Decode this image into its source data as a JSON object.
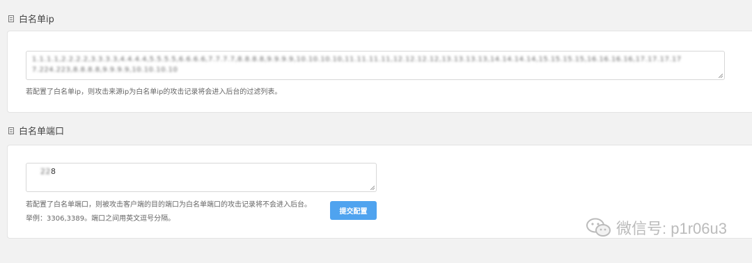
{
  "sections": {
    "whitelist_ip": {
      "title": "白名单ip",
      "value_line1": "1.1.1.1,2.2.2.2,3.3.3.3,4.4.4.4,5.5.5.5,6.6.6.6,7.7.7.7,8.8.8.8,9.9.9.9,10.10.10.10,11.11.11.11,12.12.12.12,13.13.13.13,14.14.14.14,15.15.15.15,16.16.16.16,17.17.17.17",
      "value_line2": "7.224.223,8.8.8.8,9.9.9.9,10.10.10.10",
      "help": "若配置了白名单ip，则攻击来源ip为白名单ip的攻击记录将会进入后台的过滤列表。"
    },
    "whitelist_port": {
      "title": "白名单端口",
      "value_prefix": "22",
      "value_suffix": "8",
      "help": "若配置了白名单端口，则被攻击客户端的目的端口为白名单端口的攻击记录将不会进入后台。",
      "example": "举例：3306,3389。端口之间用英文逗号分隔。",
      "submit_label": "提交配置"
    }
  },
  "watermark": {
    "text": "微信号: p1r06u3"
  },
  "icons": {
    "section": "document-icon",
    "watermark": "wechat-icon"
  }
}
